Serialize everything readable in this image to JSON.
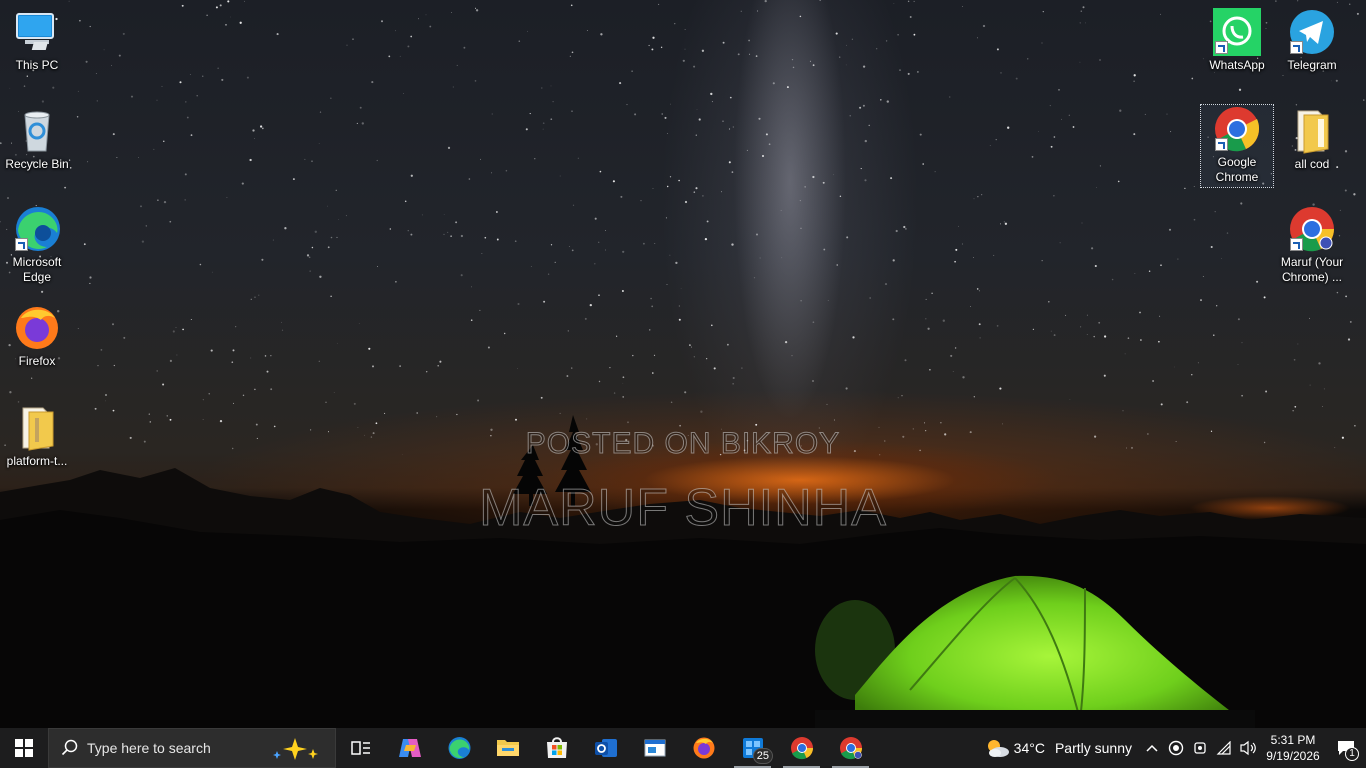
{
  "desktop": {
    "watermark_line1": "POSTED ON BIKROY",
    "watermark_line2": "MARUF SHINHA",
    "left_icons": [
      {
        "label": "This PC",
        "icon": "this-pc-icon"
      },
      {
        "label": "Recycle Bin",
        "icon": "recycle-bin-icon"
      },
      {
        "label": "Microsoft Edge",
        "icon": "edge-icon"
      },
      {
        "label": "Firefox",
        "icon": "firefox-icon"
      },
      {
        "label": "platform-t...",
        "icon": "folder-icon"
      }
    ],
    "right_icons": [
      {
        "label": "WhatsApp",
        "icon": "whatsapp-icon"
      },
      {
        "label": "Telegram",
        "icon": "telegram-icon"
      },
      {
        "label": "Google Chrome",
        "icon": "chrome-icon",
        "selected": true
      },
      {
        "label": "all cod",
        "icon": "folder-icon"
      },
      {
        "label": "Maruf (Your Chrome) ...",
        "icon": "chrome-profile-icon"
      }
    ]
  },
  "taskbar": {
    "search_placeholder": "Type here to search",
    "apps": [
      {
        "name": "task-view",
        "icon": "task-view-icon"
      },
      {
        "name": "copilot",
        "icon": "copilot-icon"
      },
      {
        "name": "edge",
        "icon": "edge-icon"
      },
      {
        "name": "file-explorer",
        "icon": "folder-icon"
      },
      {
        "name": "microsoft-store",
        "icon": "store-icon"
      },
      {
        "name": "outlook",
        "icon": "outlook-icon"
      },
      {
        "name": "app-window",
        "icon": "window-icon"
      },
      {
        "name": "firefox",
        "icon": "firefox-icon"
      },
      {
        "name": "windows-app",
        "icon": "app-grid-icon",
        "badge": "25"
      },
      {
        "name": "chrome",
        "icon": "chrome-icon"
      },
      {
        "name": "chrome-profile",
        "icon": "chrome-profile-icon"
      }
    ],
    "weather": {
      "temp": "34°C",
      "condition": "Partly sunny"
    },
    "clock": {
      "time": "5:31 PM",
      "date": "9/19/2026"
    },
    "notification_count": "1"
  }
}
